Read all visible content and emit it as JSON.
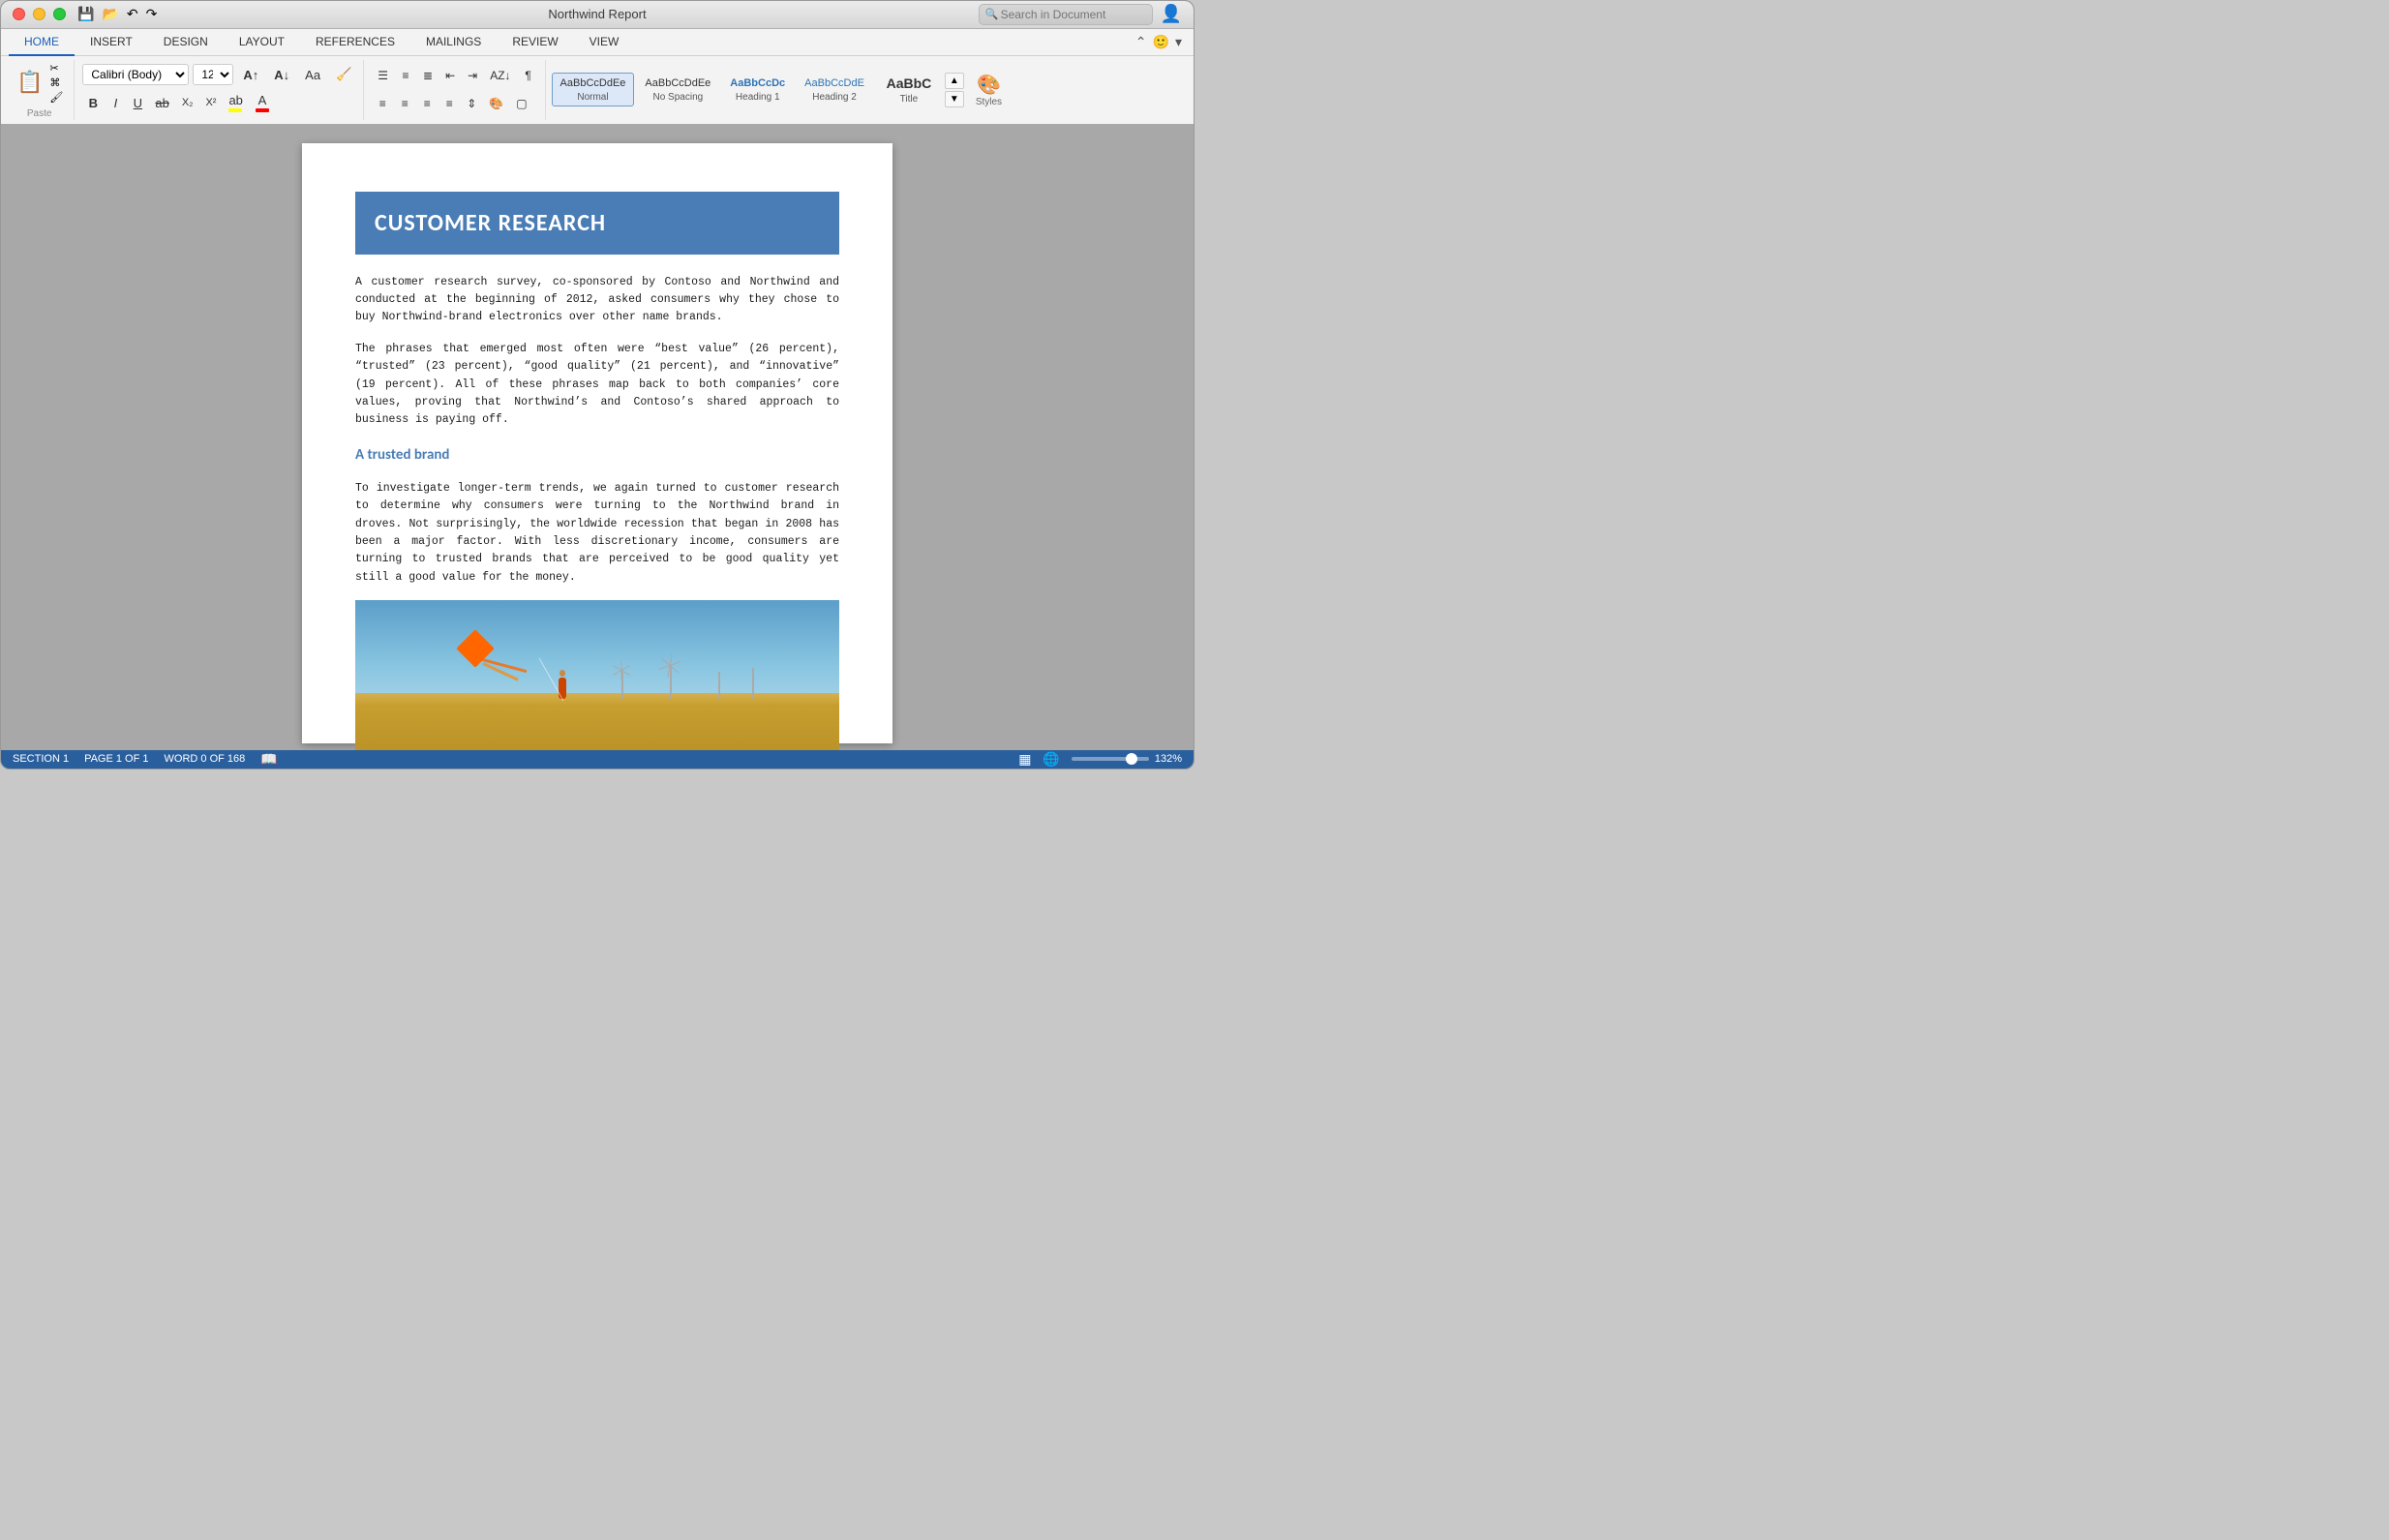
{
  "window": {
    "title": "Northwind Report",
    "search_placeholder": "Search in Document"
  },
  "ribbon": {
    "tabs": [
      {
        "id": "home",
        "label": "HOME",
        "active": true
      },
      {
        "id": "insert",
        "label": "INSERT"
      },
      {
        "id": "design",
        "label": "DESIGN"
      },
      {
        "id": "layout",
        "label": "LAYOUT"
      },
      {
        "id": "references",
        "label": "REFERENCES"
      },
      {
        "id": "mailings",
        "label": "MAILINGS"
      },
      {
        "id": "review",
        "label": "REVIEW"
      },
      {
        "id": "view",
        "label": "VIEW"
      }
    ],
    "clipboard": {
      "paste_label": "Paste"
    },
    "font": {
      "name": "Calibri (Body)",
      "size": "12"
    },
    "styles": [
      {
        "id": "normal",
        "preview": "AaBbCcDdEe",
        "label": "Normal",
        "active": true
      },
      {
        "id": "no-spacing",
        "preview": "AaBbCcDdEe",
        "label": "No Spacing"
      },
      {
        "id": "heading1",
        "preview": "AaBbCcDc",
        "label": "Heading 1"
      },
      {
        "id": "heading2",
        "preview": "AaBbCcDdE",
        "label": "Heading 2"
      },
      {
        "id": "title",
        "preview": "AaBbC",
        "label": "Title"
      }
    ]
  },
  "document": {
    "heading": "CUSTOMER RESEARCH",
    "paragraph1": "A customer research survey, co-sponsored by Contoso and Northwind and conducted at the beginning of 2012, asked consumers why they chose to buy Northwind-brand electronics over other name brands.",
    "paragraph2": "The phrases that emerged most often were “best value” (26 percent), “trusted” (23 percent), “good quality” (21 percent), and “innovative” (19 percent). All of these phrases map back to both companies’ core values, proving that Northwind’s and Contoso’s shared approach to business is paying off.",
    "subheading": "A trusted brand",
    "paragraph3": "To investigate longer-term trends, we again turned to customer research to determine why consumers were turning to the Northwind brand in droves. Not surprisingly, the worldwide recession that began in 2008 has been a major factor. With less discretionary income, consumers are turning to trusted brands that are perceived to be good quality yet still a good value for the money."
  },
  "status_bar": {
    "section": "SECTION 1",
    "page": "PAGE 1 OF 1",
    "word_count": "WORD 0 OF 168",
    "zoom": "132%"
  },
  "icons": {
    "search": "🔍",
    "paste": "📋",
    "cut": "✂",
    "copy": "⎘",
    "format_painter": "🖌",
    "bold": "B",
    "italic": "I",
    "underline": "U",
    "strikethrough": "S",
    "subscript": "X₂",
    "superscript": "X²",
    "font_color": "A",
    "highlight": "ab",
    "bullets": "☰",
    "numbering": "≡",
    "multilevel": "≣",
    "decrease_indent": "⇤",
    "increase_indent": "⇥",
    "sort": "AZ",
    "show_para": "¶",
    "align_left": "☰",
    "align_center": "☰",
    "align_right": "☰",
    "justify": "☰",
    "line_spacing": "⇅",
    "shading": "🎨",
    "border": "□",
    "undo": "↶",
    "redo": "↷",
    "save": "💾",
    "open": "📂",
    "styles_more": "▾",
    "styles_panel": "🎨",
    "chevron_up": "⌃",
    "chevron_down": "⌄"
  }
}
